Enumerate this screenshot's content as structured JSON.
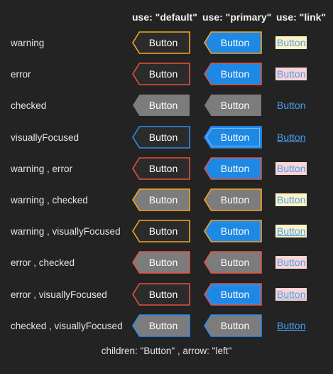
{
  "headers": [
    "use: \"default\"",
    "use: \"primary\"",
    "use: \"link\""
  ],
  "footer": "children: \"Button\" , arrow: \"left\"",
  "button_label": "Button",
  "colors": {
    "background": "#232323",
    "default_fill": "#2b2b2b",
    "primary_fill": "#1e88e5",
    "checked_fill": "#7c7c7c",
    "warning": "#f5a623",
    "error": "#e5533d",
    "focus": "#2f8cf0",
    "link_text": "#4a9ff5",
    "link_warning_bg": "#fff3c4",
    "link_error_bg": "#fbd4d4"
  },
  "rows": [
    {
      "label": "warning",
      "states": [
        "warning"
      ]
    },
    {
      "label": "error",
      "states": [
        "error"
      ]
    },
    {
      "label": "checked",
      "states": [
        "checked"
      ]
    },
    {
      "label": "visuallyFocused",
      "states": [
        "focused"
      ]
    },
    {
      "label": "warning , error",
      "states": [
        "warning",
        "error"
      ]
    },
    {
      "label": "warning , checked",
      "states": [
        "warning",
        "checked"
      ]
    },
    {
      "label": "warning , visuallyFocused",
      "states": [
        "warning",
        "focused"
      ]
    },
    {
      "label": "error , checked",
      "states": [
        "error",
        "checked"
      ]
    },
    {
      "label": "error , visuallyFocused",
      "states": [
        "error",
        "focused"
      ]
    },
    {
      "label": "checked , visuallyFocused",
      "states": [
        "checked",
        "focused"
      ]
    }
  ]
}
